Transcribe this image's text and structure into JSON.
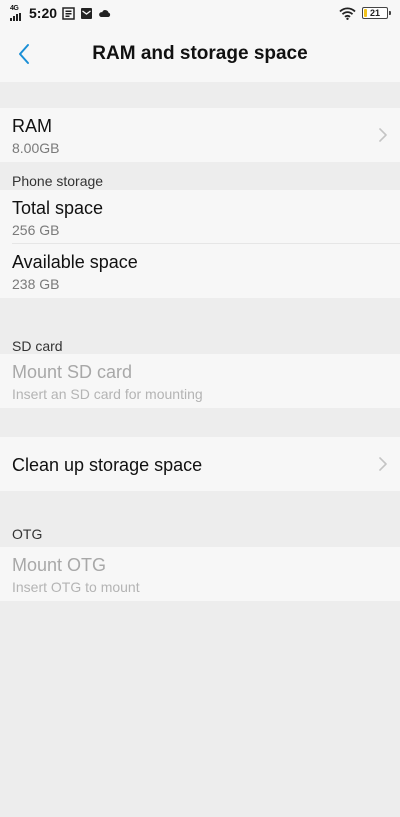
{
  "status_bar": {
    "network": "4G",
    "time": "5:20",
    "battery_level": "21",
    "battery_fraction": 0.21,
    "battery_color": "#f2c21b",
    "icons": [
      "signal-icon",
      "notification-icon",
      "mail-icon",
      "cloud-icon",
      "wifi-icon",
      "battery-icon"
    ]
  },
  "header": {
    "title": "RAM and storage space",
    "back_icon": "chevron-left-icon",
    "accent_color": "#1a8fd6"
  },
  "ram": {
    "title": "RAM",
    "value": "8.00GB"
  },
  "phone_storage": {
    "label": "Phone storage",
    "total": {
      "title": "Total space",
      "value": "256 GB"
    },
    "available": {
      "title": "Available space",
      "value": "238 GB"
    }
  },
  "sd_card": {
    "label": "SD card",
    "mount": {
      "title": "Mount SD card",
      "value": "Insert an SD card for mounting"
    }
  },
  "cleanup": {
    "title": "Clean up storage space"
  },
  "otg": {
    "label": "OTG",
    "mount": {
      "title": "Mount OTG",
      "value": "Insert OTG to mount"
    }
  }
}
